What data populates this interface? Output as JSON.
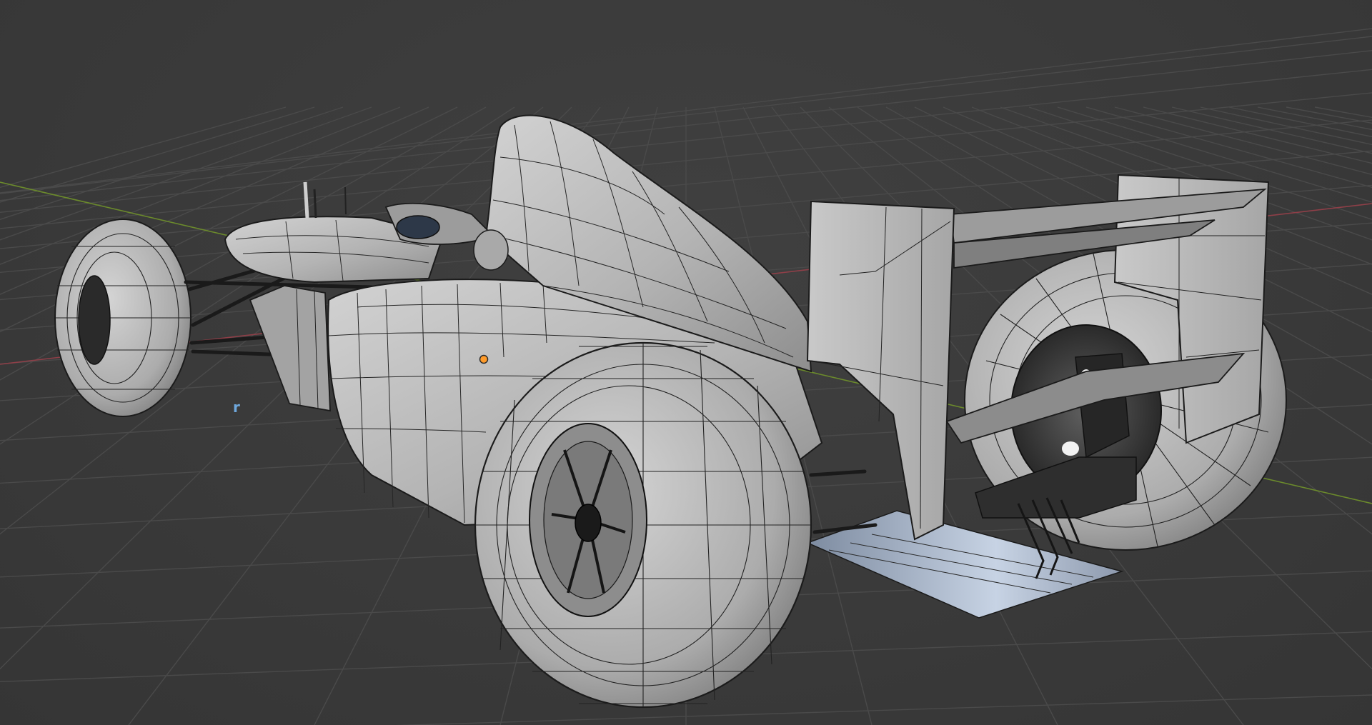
{
  "viewport": {
    "object_label": "r",
    "colors": {
      "background": "#393939",
      "grid": "#4a4a4a",
      "x_axis": "#8e3f48",
      "y_axis": "#6b8a2c",
      "mesh_fill": "#b9b9b9",
      "mesh_shadow": "#8a8a8a",
      "wire": "#1b1b1b",
      "origin_point": "#ff9b2a",
      "label": "#6fa8dc"
    },
    "icons": [
      "origin-point-icon"
    ]
  }
}
